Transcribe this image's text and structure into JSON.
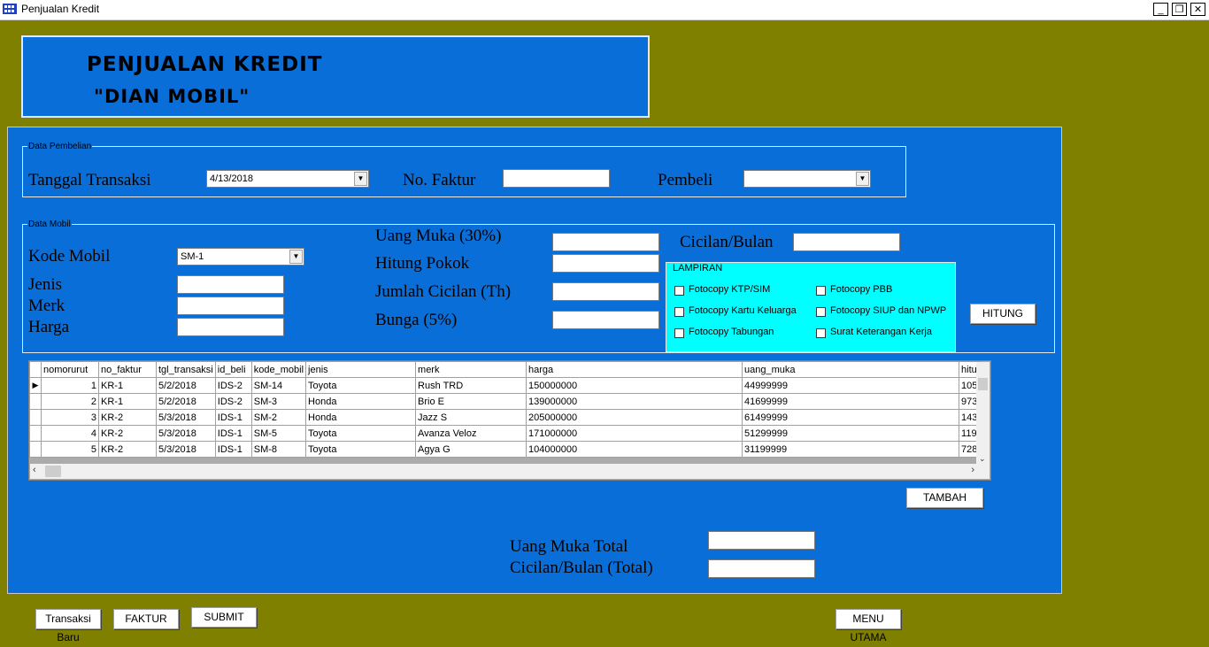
{
  "window": {
    "title": "Penjualan Kredit",
    "min": "_",
    "restore": "❐",
    "close": "✕"
  },
  "header": {
    "title": "PENJUALAN KREDIT",
    "subtitle": "\"DIAN MOBIL\""
  },
  "pembelian": {
    "group_label": "Data Pembelian",
    "tanggal_label": "Tanggal Transaksi",
    "tanggal_value": "4/13/2018",
    "faktur_label": "No. Faktur",
    "faktur_value": "",
    "pembeli_label": "Pembeli",
    "pembeli_value": ""
  },
  "mobil": {
    "group_label": "Data Mobil",
    "kode_label": "Kode Mobil",
    "kode_value": "SM-1",
    "jenis_label": "Jenis",
    "merk_label": "Merk",
    "harga_label": "Harga",
    "uang_muka_label": "Uang Muka (30%)",
    "hitung_pokok_label": "Hitung Pokok",
    "jumlah_cicilan_label": "Jumlah Cicilan (Th)",
    "bunga_label": "Bunga (5%)",
    "cicilan_label": "Cicilan/Bulan"
  },
  "lampiran": {
    "title": "LAMPIRAN",
    "items": [
      "Fotocopy KTP/SIM",
      "Fotocopy PBB",
      "Fotocopy Kartu Keluarga",
      "Fotocopy SIUP dan NPWP",
      "Fotocopy Tabungan",
      "Surat Keterangan Kerja"
    ]
  },
  "buttons": {
    "hitung": "HITUNG",
    "tambah": "TAMBAH",
    "transaksi_baru": "Transaksi Baru",
    "faktur": "FAKTUR",
    "submit": "SUBMIT",
    "menu_utama": "MENU UTAMA"
  },
  "grid": {
    "columns": [
      "nomorurut",
      "no_faktur",
      "tgl_transaksi",
      "id_beli",
      "kode_mobil",
      "jenis",
      "merk",
      "harga",
      "uang_muka",
      "hitu"
    ],
    "rows": [
      [
        "1",
        "KR-1",
        "5/2/2018",
        "IDS-2",
        "SM-14",
        "Toyota",
        "Rush TRD",
        "150000000",
        "44999999",
        "105"
      ],
      [
        "2",
        "KR-1",
        "5/2/2018",
        "IDS-2",
        "SM-3",
        "Honda",
        "Brio E",
        "139000000",
        "41699999",
        "973"
      ],
      [
        "3",
        "KR-2",
        "5/3/2018",
        "IDS-1",
        "SM-2",
        "Honda",
        "Jazz S",
        "205000000",
        "61499999",
        "143"
      ],
      [
        "4",
        "KR-2",
        "5/3/2018",
        "IDS-1",
        "SM-5",
        "Toyota",
        "Avanza Veloz",
        "171000000",
        "51299999",
        "119"
      ],
      [
        "5",
        "KR-2",
        "5/3/2018",
        "IDS-1",
        "SM-8",
        "Toyota",
        "Agya G",
        "104000000",
        "31199999",
        "728"
      ]
    ]
  },
  "totals": {
    "uang_muka_total_label": "Uang Muka Total",
    "cicilan_total_label": "Cicilan/Bulan (Total)"
  },
  "colors": {
    "form_bg": "#0a6ed8",
    "outer_bg": "#808000",
    "lampiran_bg": "#00ffff"
  }
}
